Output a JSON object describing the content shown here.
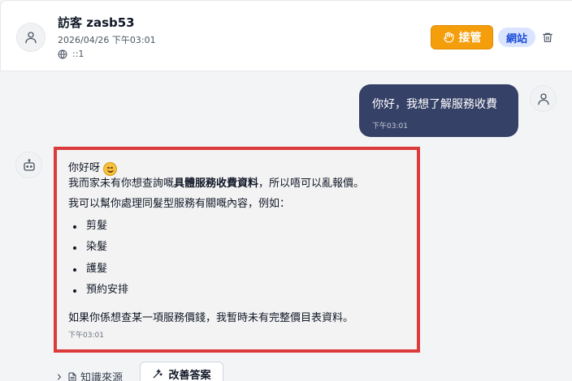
{
  "header": {
    "visitor_name": "訪客 zasb53",
    "visitor_time": "2026/04/26 下午03:01",
    "visitor_ip": "::1",
    "takeover_label": "接管",
    "channel_badge": "網站"
  },
  "messages": {
    "user": {
      "text": "你好，我想了解服務收費",
      "time": "下午03:01"
    },
    "bot": {
      "greeting": "你好呀",
      "line1_pre": "我而家未有你想查詢嘅",
      "line1_bold": "具體服務收費資料",
      "line1_post": "，所以唔可以亂報價。",
      "line2": "我可以幫你處理同髮型服務有關嘅內容，例如：",
      "items": [
        "剪髮",
        "染髮",
        "護髮",
        "預約安排"
      ],
      "line3": "如果你係想查某一項服務價錢，我暫時未有完整價目表資料。",
      "time": "下午03:01"
    }
  },
  "actions": {
    "sources_label": "知識來源",
    "improve_label": "改善答案"
  },
  "colors": {
    "takeover": "#f59e0b",
    "user_bubble": "#354166",
    "highlight_border": "#dc3b3b",
    "badge_bg": "#dbe4ff",
    "badge_text": "#1d4ed8"
  }
}
